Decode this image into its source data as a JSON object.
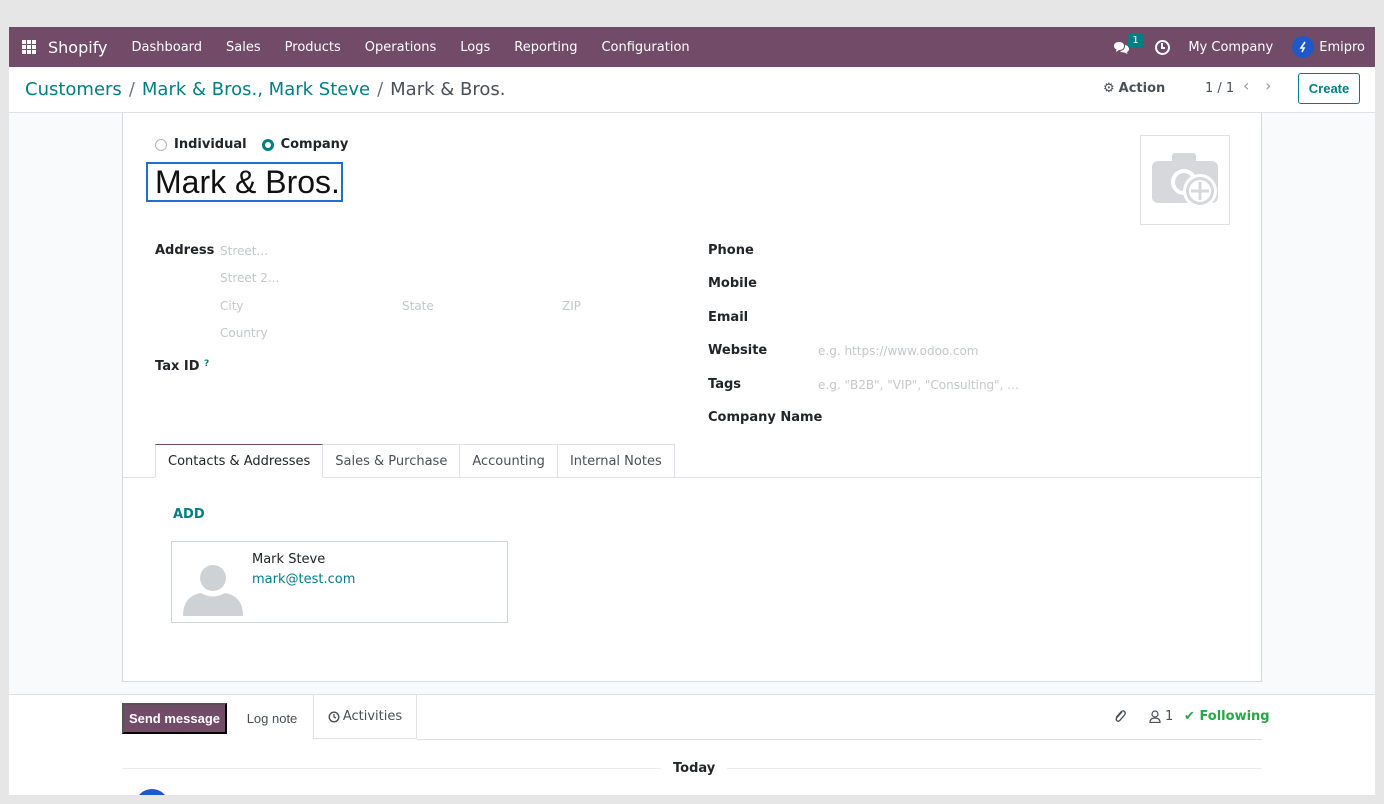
{
  "navbar": {
    "brand": "Shopify",
    "menu": [
      "Dashboard",
      "Sales",
      "Products",
      "Operations",
      "Logs",
      "Reporting",
      "Configuration"
    ],
    "chat_badge": "1",
    "company": "My Company",
    "user": "Emipro"
  },
  "breadcrumb": {
    "items": [
      "Customers",
      "Mark & Bros., Mark Steve"
    ],
    "current": "Mark & Bros.",
    "separator": "/"
  },
  "control": {
    "action_label": "Action",
    "pager": "1 / 1",
    "create_label": "Create"
  },
  "form": {
    "type_options": [
      "Individual",
      "Company"
    ],
    "selected_type": "Company",
    "name": "Mark & Bros.",
    "address_label": "Address",
    "placeholders": {
      "street": "Street...",
      "street2": "Street 2...",
      "city": "City",
      "state": "State",
      "zip": "ZIP",
      "country": "Country",
      "website": "e.g. https://www.odoo.com",
      "tags": "e.g. \"B2B\", \"VIP\", \"Consulting\", ..."
    },
    "tax_label": "Tax ID",
    "tax_help": "?",
    "right_labels": {
      "phone": "Phone",
      "mobile": "Mobile",
      "email": "Email",
      "website": "Website",
      "tags": "Tags",
      "company_name": "Company Name"
    }
  },
  "tabs": [
    "Contacts & Addresses",
    "Sales & Purchase",
    "Accounting",
    "Internal Notes"
  ],
  "active_tab": "Contacts & Addresses",
  "contacts": {
    "add_label": "ADD",
    "items": [
      {
        "name": "Mark Steve",
        "email": "mark@test.com"
      }
    ]
  },
  "chatter": {
    "send_message": "Send message",
    "log_note": "Log note",
    "activities": "Activities",
    "followers": "1",
    "following": "Following",
    "today": "Today"
  },
  "colors": {
    "brand": "#714b67",
    "accent": "#017e84",
    "focus": "#1f6fd1",
    "success": "#28a745"
  }
}
